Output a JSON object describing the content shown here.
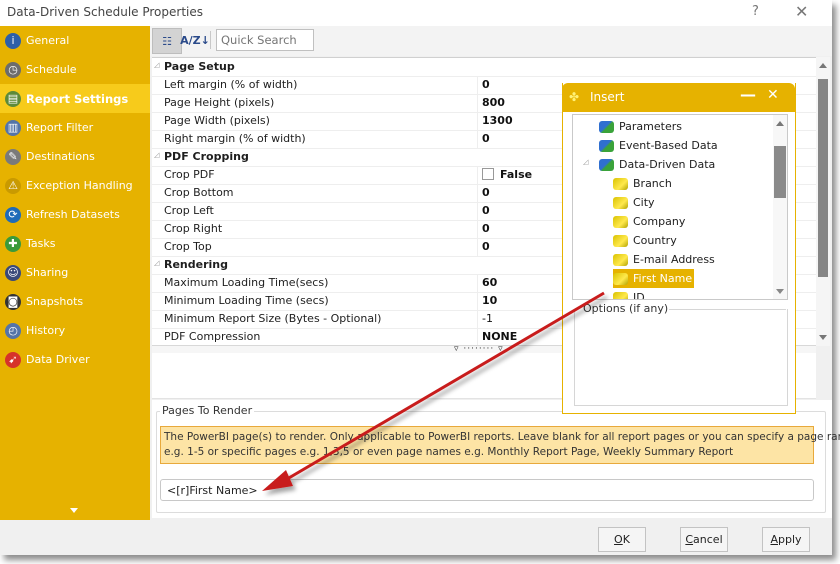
{
  "window": {
    "title": "Data-Driven Schedule Properties",
    "help_label": "?",
    "close_label": "✕"
  },
  "sidebar": {
    "items": [
      {
        "label": "General",
        "icon": "info-icon",
        "glyph": "i",
        "color": "#2d5fa8"
      },
      {
        "label": "Schedule",
        "icon": "clock-icon",
        "glyph": "◷",
        "color": "#6c6c6c"
      },
      {
        "label": "Report Settings",
        "icon": "report-settings-icon",
        "glyph": "▤",
        "color": "#5c8a3a",
        "active": true
      },
      {
        "label": "Report Filter",
        "icon": "database-filter-icon",
        "glyph": "▥",
        "color": "#5474a8"
      },
      {
        "label": "Destinations",
        "icon": "destinations-icon",
        "glyph": "✎",
        "color": "#7a7a7a"
      },
      {
        "label": "Exception Handling",
        "icon": "warning-icon",
        "glyph": "⚠",
        "color": "#c99a00"
      },
      {
        "label": "Refresh Datasets",
        "icon": "refresh-datasets-icon",
        "glyph": "⟳",
        "color": "#1f6bb8"
      },
      {
        "label": "Tasks",
        "icon": "tasks-icon",
        "glyph": "✚",
        "color": "#3a9a3a"
      },
      {
        "label": "Sharing",
        "icon": "sharing-icon",
        "glyph": "☺",
        "color": "#3a4a7a"
      },
      {
        "label": "Snapshots",
        "icon": "camera-icon",
        "glyph": "◙",
        "color": "#333333"
      },
      {
        "label": "History",
        "icon": "history-icon",
        "glyph": "◴",
        "color": "#5474a8"
      },
      {
        "label": "Data Driver",
        "icon": "data-driver-icon",
        "glyph": "➹",
        "color": "#d6332a"
      }
    ],
    "scroll_down_label": "▼"
  },
  "toolbar": {
    "categorized_label": "☷",
    "sort_label": "A/Z↓",
    "search_placeholder": "Quick Search"
  },
  "grid": {
    "rows": [
      {
        "type": "category",
        "label": "Page Setup"
      },
      {
        "label": "Left margin (% of width)",
        "value": "0"
      },
      {
        "label": "Page Height (pixels)",
        "value": "800"
      },
      {
        "label": "Page Width (pixels)",
        "value": "1300"
      },
      {
        "label": "Right margin (% of width)",
        "value": "0"
      },
      {
        "type": "category",
        "label": "PDF Cropping"
      },
      {
        "label": "Crop PDF",
        "value": "False",
        "checkbox": true
      },
      {
        "label": "Crop Bottom",
        "value": "0"
      },
      {
        "label": "Crop Left",
        "value": "0"
      },
      {
        "label": "Crop Right",
        "value": "0"
      },
      {
        "label": "Crop Top",
        "value": "0"
      },
      {
        "type": "category",
        "label": "Rendering"
      },
      {
        "label": "Maximum Loading Time(secs)",
        "value": "60"
      },
      {
        "label": "Minimum Loading Time (secs)",
        "value": "10"
      },
      {
        "label": "Minimum Report Size (Bytes - Optional)",
        "value": "-1",
        "normal": true
      },
      {
        "label": "PDF Compression",
        "value": "NONE"
      }
    ]
  },
  "pages_to_render": {
    "legend": "Pages To Render",
    "note_line1": "The PowerBI page(s) to render. Only applicable to PowerBI reports. Leave blank for all report pages or you can specify a page range",
    "note_line2": "e.g. 1-5 or specific pages e.g. 1,3,5 or even page names e.g. Monthly Report Page, Weekly Summary Report",
    "value": "<[r]First Name>"
  },
  "buttons": {
    "ok": {
      "mnemonic": "O",
      "rest": "K"
    },
    "cancel": {
      "mnemonic": "C",
      "rest": "ancel"
    },
    "apply": {
      "mnemonic": "A",
      "rest": "pply"
    }
  },
  "insert_panel": {
    "title": "Insert",
    "minimize_label": "—",
    "close_label": "✕",
    "tree": [
      {
        "label": "Parameters",
        "level": 0,
        "icon": "blue"
      },
      {
        "label": "Event-Based Data",
        "level": 0,
        "icon": "blue"
      },
      {
        "label": "Data-Driven Data",
        "level": 0,
        "icon": "blue",
        "expanded": true
      },
      {
        "label": "Branch",
        "level": 1,
        "icon": "yellow"
      },
      {
        "label": "City",
        "level": 1,
        "icon": "yellow"
      },
      {
        "label": "Company",
        "level": 1,
        "icon": "yellow"
      },
      {
        "label": "Country",
        "level": 1,
        "icon": "yellow"
      },
      {
        "label": "E-mail Address",
        "level": 1,
        "icon": "yellow"
      },
      {
        "label": "First Name",
        "level": 1,
        "icon": "yellow",
        "selected": true
      },
      {
        "label": "ID",
        "level": 1,
        "icon": "yellow"
      }
    ],
    "options_legend": "Options (if any)"
  },
  "annotation": {
    "arrow_color": "#c81e1e"
  }
}
